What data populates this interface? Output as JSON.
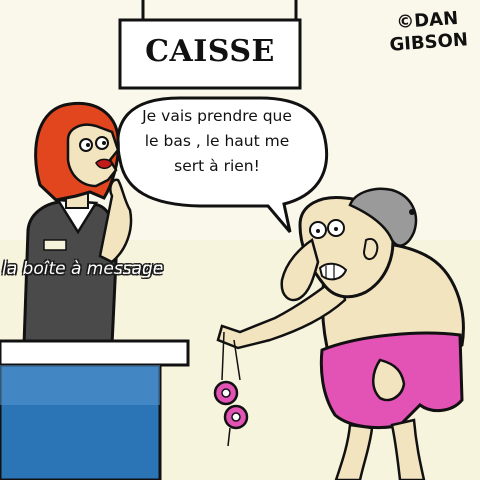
{
  "sign": {
    "text": "CAISSE"
  },
  "credit": {
    "line1": "©DAN",
    "line2": "GIBSON"
  },
  "speech": {
    "lines": [
      "Je vais prendre que",
      "le bas , le haut me",
      "sert à rien!"
    ]
  },
  "watermark": {
    "text": "la boîte à message"
  },
  "colors": {
    "background": "#f5f2dc",
    "cashier_hair": "#e2461e",
    "counter": "#2b74b6",
    "bikini": "#e253b5",
    "skin": "#f3e4c0"
  }
}
